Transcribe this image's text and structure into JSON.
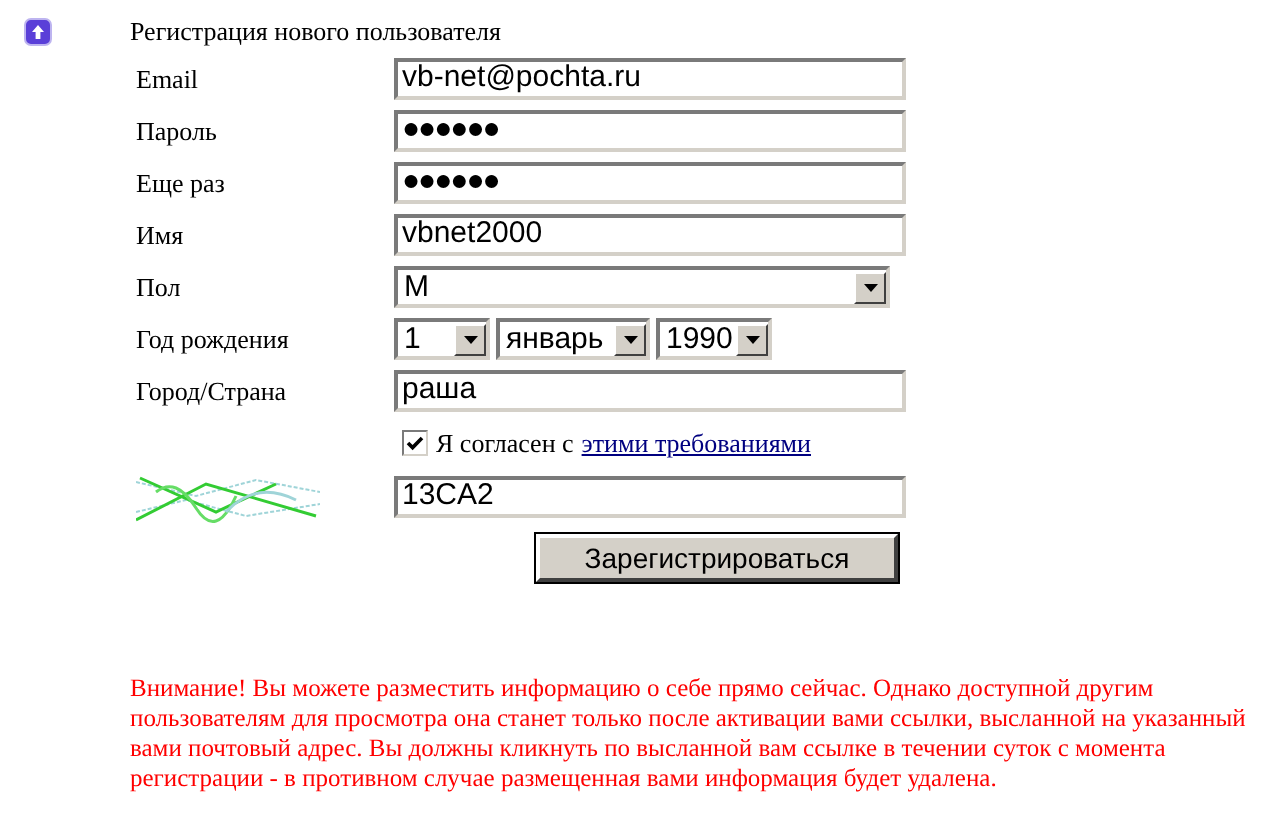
{
  "title": "Регистрация нового пользователя",
  "fields": [
    {
      "kind": "text",
      "label": "Email",
      "value": "vb-net@pochta.ru"
    },
    {
      "kind": "password",
      "label": "Пароль",
      "value": "●●●●●●"
    },
    {
      "kind": "password",
      "label": "Еще раз",
      "value": "●●●●●●"
    },
    {
      "kind": "text",
      "label": "Имя",
      "value": "vbnet2000"
    },
    {
      "kind": "select",
      "label": "Пол",
      "selects": [
        "М"
      ]
    },
    {
      "kind": "selects",
      "label": "Год рождения",
      "selects": [
        "1",
        "январь",
        "1990"
      ]
    },
    {
      "kind": "text",
      "label": "Город/Страна",
      "value": "раша"
    }
  ],
  "agreement": {
    "checked": true,
    "text": "Я согласен с",
    "link": "этими требованиями"
  },
  "captcha": {
    "kind": "picture",
    "value": "13CA2"
  },
  "submit": "Зарегистрироваться",
  "notice": "Внимание! Вы можете разместить информацию о себе прямо сейчас. Однако доступной другим пользователям для просмотра она станет только после активации вами ссылки, высланной на указанный вами почтовый адрес. Вы должны кликнуть по высланной вам ссылке в течении суток с момента регистрации - в противном случае размещенная вами информация будет удалена."
}
